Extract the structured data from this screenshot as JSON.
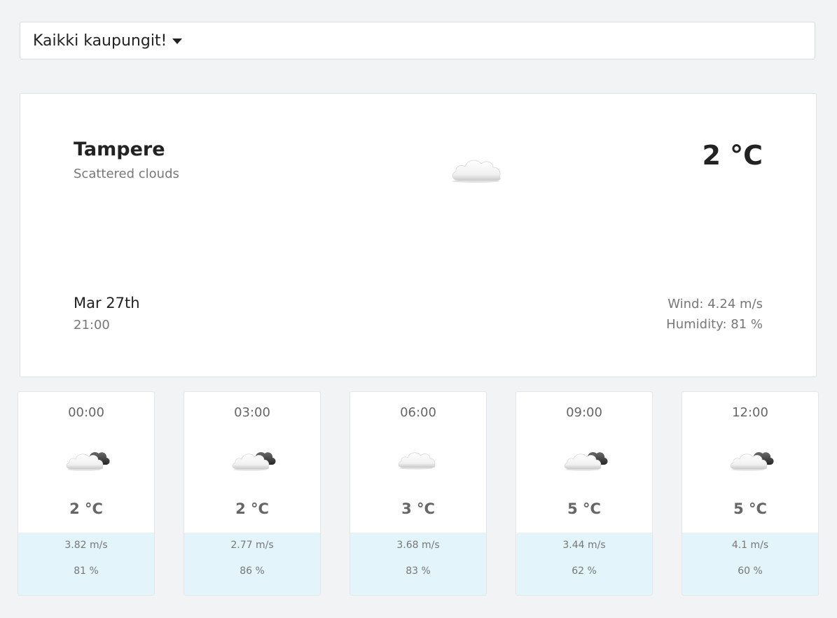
{
  "city_select": {
    "label": "Kaikki kaupungit!"
  },
  "current": {
    "city": "Tampere",
    "description": "Scattered clouds",
    "temperature": "2 °C",
    "date": "Mar 27th",
    "time": "21:00",
    "wind": "Wind: 4.24 m/s",
    "humidity": "Humidity: 81 %",
    "icon": "cloud-icon"
  },
  "forecast": [
    {
      "time": "00:00",
      "temperature": "2 °C",
      "wind": "3.82 m/s",
      "humidity": "81 %",
      "icon": "cloud-dark-cloud-icon"
    },
    {
      "time": "03:00",
      "temperature": "2 °C",
      "wind": "2.77 m/s",
      "humidity": "86 %",
      "icon": "cloud-dark-cloud-icon"
    },
    {
      "time": "06:00",
      "temperature": "3 °C",
      "wind": "3.68 m/s",
      "humidity": "83 %",
      "icon": "cloud-icon"
    },
    {
      "time": "09:00",
      "temperature": "5 °C",
      "wind": "3.44 m/s",
      "humidity": "62 %",
      "icon": "cloud-dark-cloud-icon"
    },
    {
      "time": "12:00",
      "temperature": "5 °C",
      "wind": "4.1 m/s",
      "humidity": "60 %",
      "icon": "cloud-dark-cloud-icon"
    }
  ],
  "colors": {
    "background": "#f2f3f5",
    "card": "#ffffff",
    "forecast_footer": "#e3f4fb",
    "muted_text": "#777777"
  }
}
